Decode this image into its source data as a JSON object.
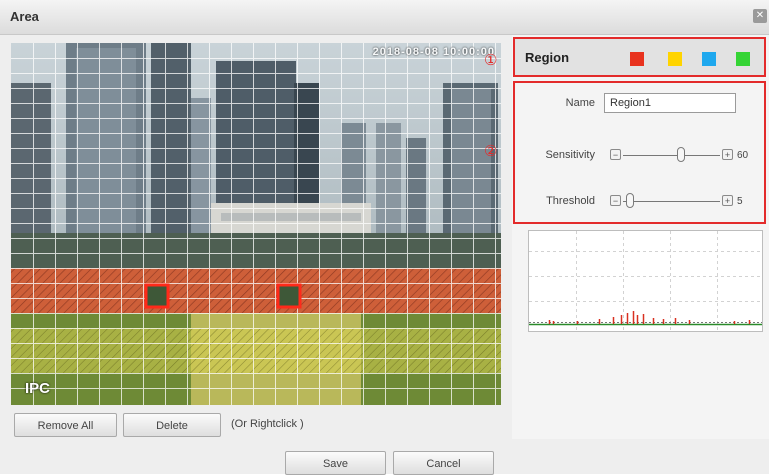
{
  "window": {
    "title": "Area"
  },
  "video": {
    "timestamp": "2018-08-08 10:00:00",
    "channel_name": "IPC"
  },
  "buttons": {
    "remove_all": "Remove All",
    "delete": "Delete",
    "save": "Save",
    "cancel": "Cancel"
  },
  "hint": "(Or Rightclick )",
  "region": {
    "label": "Region",
    "colors": [
      "#e8321e",
      "#ffd400",
      "#1fa8ee",
      "#35d435"
    ],
    "name_label": "Name",
    "name_value": "Region1",
    "sensitivity_label": "Sensitivity",
    "sensitivity_value": "60",
    "sensitivity_level": 60,
    "threshold_label": "Threshold",
    "threshold_value": "5",
    "threshold_level": 5
  },
  "markers": {
    "one": "①",
    "two": "②"
  }
}
